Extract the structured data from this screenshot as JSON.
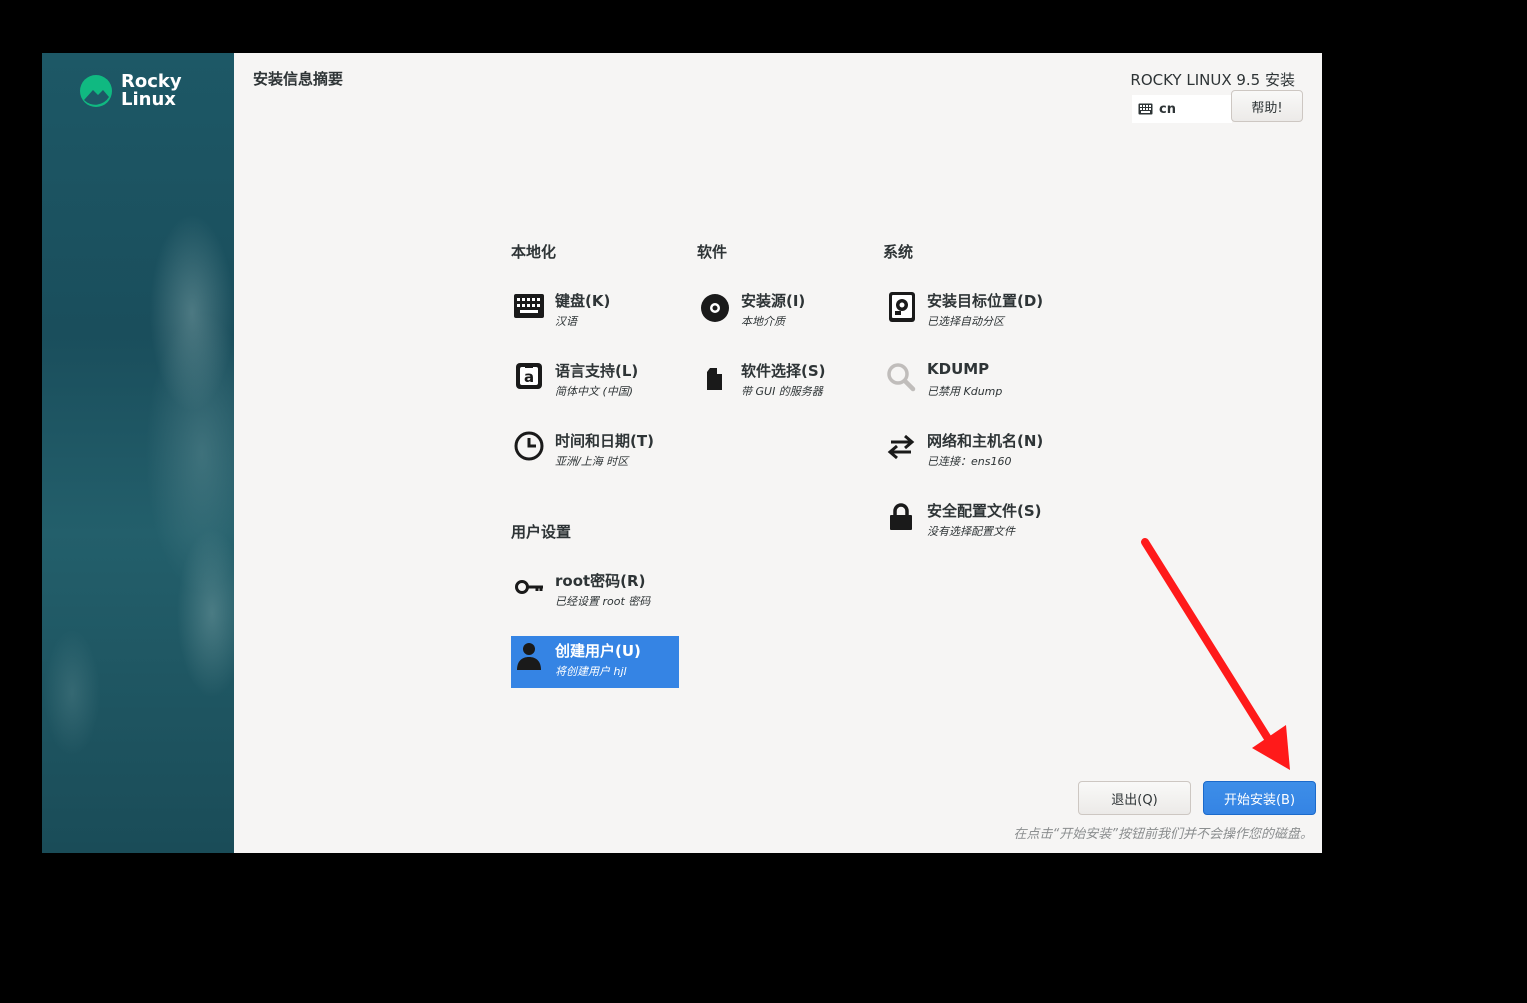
{
  "sidebar": {
    "logo_line1": "Rocky",
    "logo_line2": "Linux",
    "logo_color": "#10b981"
  },
  "header": {
    "page_title": "安装信息摘要",
    "product_title": "ROCKY LINUX 9.5 安装",
    "keyboard_layout": "cn",
    "help_label": "帮助!"
  },
  "sections": {
    "localization": "本地化",
    "software": "软件",
    "system": "系统",
    "user_settings": "用户设置"
  },
  "spokes": {
    "keyboard": {
      "title": "键盘(K)",
      "status": "汉语",
      "icon": "keyboard-icon"
    },
    "language": {
      "title": "语言支持(L)",
      "status": "简体中文 (中国)",
      "icon": "language-icon"
    },
    "datetime": {
      "title": "时间和日期(T)",
      "status": "亚洲/上海 时区",
      "icon": "clock-icon"
    },
    "source": {
      "title": "安装源(I)",
      "status": "本地介质",
      "icon": "disc-icon"
    },
    "software_selection": {
      "title": "软件选择(S)",
      "status": "带 GUI 的服务器",
      "icon": "package-icon"
    },
    "destination": {
      "title": "安装目标位置(D)",
      "status": "已选择自动分区",
      "icon": "harddisk-icon"
    },
    "kdump": {
      "title": "KDUMP",
      "status": "已禁用 Kdump",
      "icon": "magnifier-icon"
    },
    "network": {
      "title": "网络和主机名(N)",
      "status": "已连接：ens160",
      "icon": "network-arrows-icon"
    },
    "security": {
      "title": "安全配置文件(S)",
      "status": "没有选择配置文件",
      "icon": "lock-icon"
    },
    "root_password": {
      "title": "root密码(R)",
      "status": "已经设置 root 密码",
      "icon": "key-icon"
    },
    "create_user": {
      "title": "创建用户(U)",
      "status": "将创建用户 hjl",
      "icon": "user-icon",
      "selected": true
    }
  },
  "footer": {
    "quit_label": "退出(Q)",
    "begin_label": "开始安装(B)",
    "note": "在点击“开始安装”按钮前我们并不会操作您的磁盘。"
  },
  "colors": {
    "accent": "#3584e4",
    "annotation_arrow": "#ff1a1a"
  }
}
